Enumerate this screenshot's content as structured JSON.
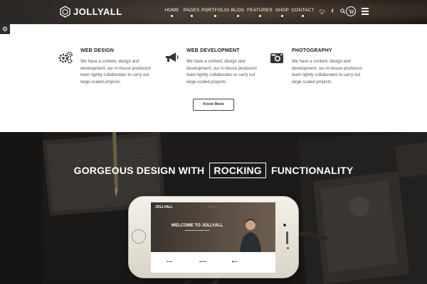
{
  "header": {
    "logo_text": "JOLLYALL",
    "nav": [
      "HOME",
      "PAGES",
      "PORTFOLIO",
      "BLOG",
      "FEATURES",
      "SHOP",
      "CONTACT"
    ],
    "icons": [
      "twitter-icon",
      "facebook-icon",
      "search-icon",
      "cart-icon",
      "menu-icon"
    ]
  },
  "services": [
    {
      "icon": "gears-icon",
      "title": "WEB DESIGN",
      "lines": [
        "We have a content, design and",
        "development, our in-house producion",
        "team tightly collaborates to carry out",
        "large-scaled projects."
      ]
    },
    {
      "icon": "megaphone-icon",
      "title": "WEB DEVELOPMENT",
      "lines": [
        "We have a content, design and",
        "development, our in-house producion",
        "team tightly collaborates to carry out",
        "large-scaled projects."
      ]
    },
    {
      "icon": "camera-icon",
      "title": "PHOTOGRAPHY",
      "lines": [
        "We have a content, design and",
        "development, our in-house producion",
        "team tightly collaborates to carry out",
        "large-scaled projects."
      ]
    }
  ],
  "know_more": "Know More",
  "hero": {
    "title_left": "GORGEOUS DESIGN WITH",
    "title_boxed": "ROCKING",
    "title_right": "FUNCTIONALITY"
  },
  "phone_screen": {
    "logo": "JOLLYALL",
    "title": "WELCOME TO JOLLYALL"
  },
  "colors": {
    "header_bg": "#2b2724",
    "hero_bg": "#1f1d1c",
    "text_dark": "#222222",
    "text_body": "#555555"
  }
}
